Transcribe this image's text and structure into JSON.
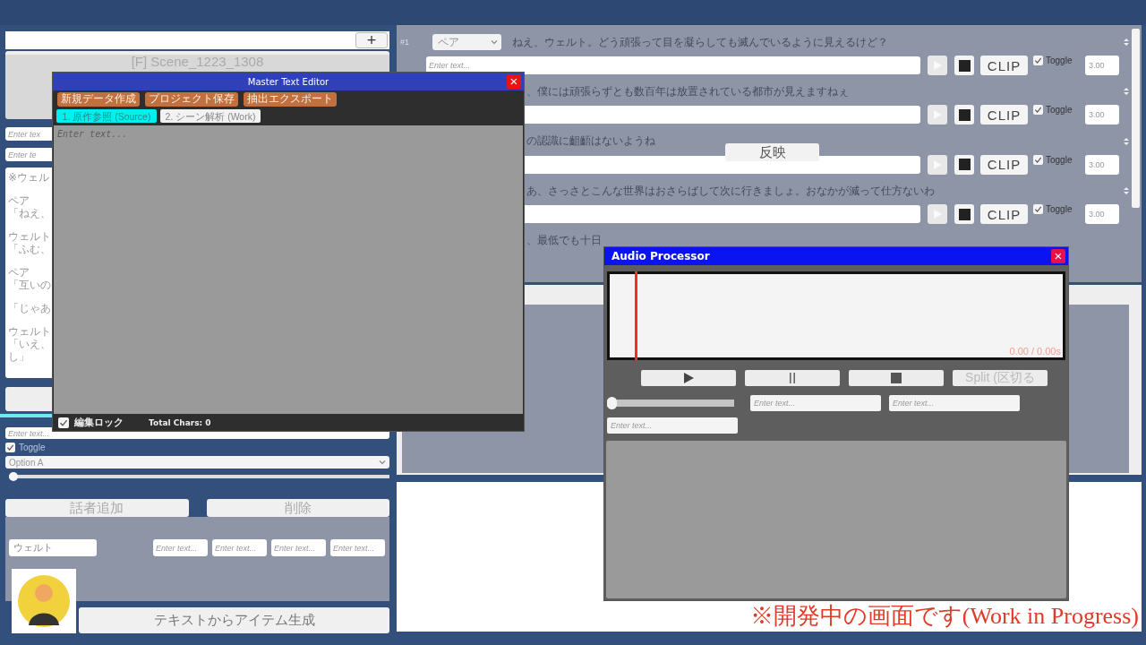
{
  "top_bar": {
    "add_button": "+"
  },
  "scene": {
    "title": "[F] Scene_1223_1308"
  },
  "left_fields": [
    {
      "placeholder": "Enter tex"
    },
    {
      "placeholder": "Enter te"
    }
  ],
  "script": [
    [
      "※ウェル"
    ],
    [
      "ペア",
      "「ねえ、"
    ],
    [
      "ウェルト",
      "「ふむ、"
    ],
    [
      "ペア",
      "「互いの"
    ],
    [
      "「じゃあ"
    ],
    [
      "ウェルト",
      "「いえ、",
      "し」"
    ]
  ],
  "settings": {
    "placeholder": "Enter text...",
    "toggle": {
      "label": "Toggle",
      "checked": true
    },
    "dropdown": "Option A",
    "slider": {
      "level": 0
    }
  },
  "speaker_buttons": [
    "話者追加",
    "削除"
  ],
  "speaker": {
    "name": "ウェルト",
    "fields": [
      {
        "placeholder": "Enter text..."
      },
      {
        "placeholder": "Enter text..."
      },
      {
        "placeholder": "Enter text..."
      },
      {
        "placeholder": "Enter text..."
      }
    ]
  },
  "generate_button": "テキストからアイテム生成",
  "lines": [
    {
      "number": "#1",
      "speaker": "ペア",
      "text": "ねえ、ウェルト。どう頑張って目を凝らしても滅んでいるように見えるけど？",
      "placeholder": "Enter text...",
      "clip": "CLIP",
      "toggle": {
        "label": "Toggle",
        "checked": true
      },
      "duration": "3.00"
    },
    {
      "text": "、僕には頑張らずとも数百年は放置されている都市が見えますねぇ",
      "clip": "CLIP",
      "toggle": {
        "label": "Toggle",
        "checked": true
      },
      "duration": "3.00"
    },
    {
      "text": "の認識に齟齬はないようね",
      "clip": "CLIP",
      "toggle": {
        "label": "Toggle",
        "checked": true
      },
      "duration": "3.00"
    },
    {
      "text": "あ、さっさとこんな世界はおさらばして次に行きましょ。おなかが減って仕方ないわ",
      "clip": "CLIP",
      "toggle": {
        "label": "Toggle",
        "checked": true
      },
      "duration": "3.00"
    },
    {
      "text": "、最低でも十日"
    }
  ],
  "reflect_button": "反映",
  "editor": {
    "title": "Master Text Editor",
    "close": "×",
    "actions": [
      "新規データ作成",
      "プロジェクト保存",
      "抽出エクスポート"
    ],
    "tabs": [
      {
        "label": "1. 原作参照 (Source)",
        "selected": true
      },
      {
        "label": "2. シーン解析 (Work)",
        "selected": false
      }
    ],
    "placeholder": "Enter text...",
    "lock": {
      "label": "編集ロック",
      "checked": true
    },
    "total": "Total Chars: 0"
  },
  "audio": {
    "title": "Audio Processor",
    "close": "×",
    "time": "0.00 / 0.00s",
    "transport": [
      {
        "kind": "play"
      },
      {
        "kind": "pause"
      },
      {
        "kind": "stop"
      },
      {
        "kind": "text",
        "label": "Split (区切る"
      }
    ],
    "position": {
      "level": 0
    },
    "fields": [
      {
        "placeholder": "Enter text..."
      },
      {
        "placeholder": "Enter text..."
      },
      {
        "placeholder": "Enter text..."
      }
    ]
  },
  "caption": "※開発中の画面です(Work in Progress)"
}
